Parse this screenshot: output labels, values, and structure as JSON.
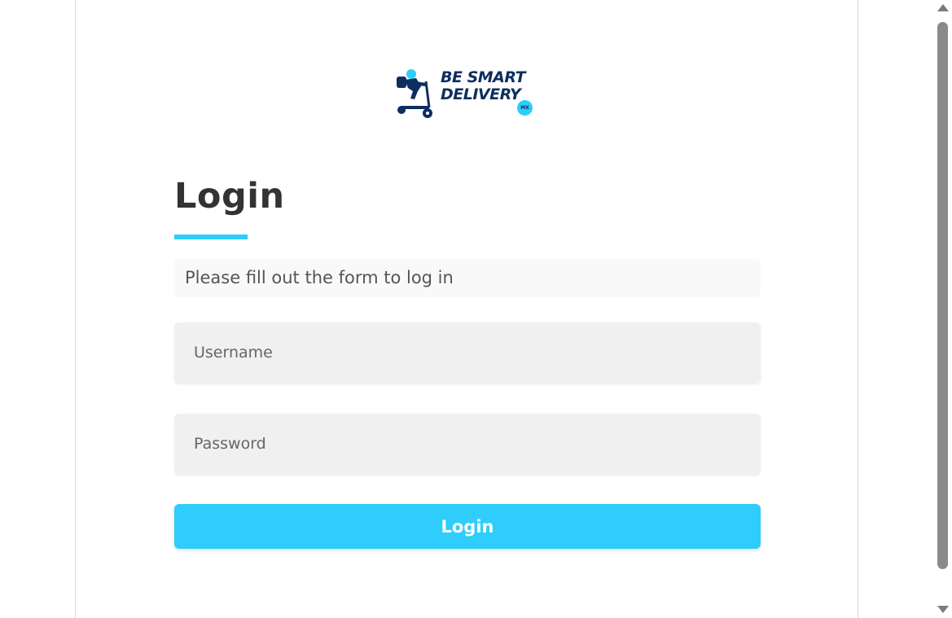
{
  "brand": {
    "line1": "BE SMART",
    "line2": "DELIVERY",
    "badge": "MX",
    "primary_color": "#0d2e5e",
    "accent_color": "#2ecdfb",
    "icon": "scooter-rider-icon"
  },
  "login": {
    "title": "Login",
    "hint": "Please fill out the form to log in",
    "username_placeholder": "Username",
    "password_placeholder": "Password",
    "submit_label": "Login"
  },
  "scrollbar": {
    "up_icon": "scroll-up-arrow-icon",
    "down_icon": "scroll-down-arrow-icon"
  }
}
